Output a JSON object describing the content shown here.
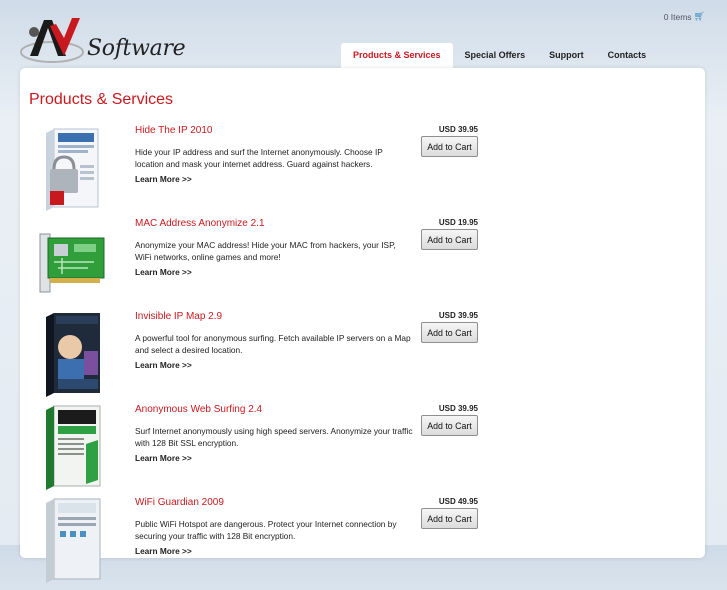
{
  "header": {
    "logo_text": "Software",
    "cart_text": "0 Items"
  },
  "nav": {
    "items": [
      {
        "label": "Products & Services",
        "active": true
      },
      {
        "label": "Special Offers",
        "active": false
      },
      {
        "label": "Support",
        "active": false
      },
      {
        "label": "Contacts",
        "active": false
      }
    ]
  },
  "main": {
    "title": "Products & Services",
    "learn_more_label": "Learn More >>",
    "add_to_cart_label": "Add to Cart",
    "products": [
      {
        "name": "Hide The IP 2010",
        "price": "USD 39.95",
        "description": "Hide your IP address and surf the Internet anonymously. Choose IP location and mask your internet address. Guard against hackers."
      },
      {
        "name": "MAC Address Anonymize 2.1",
        "price": "USD 19.95",
        "description": "Anonymize your MAC address! Hide your MAC from hackers, your ISP, WiFi networks, online games and more!"
      },
      {
        "name": "Invisible IP Map 2.9",
        "price": "USD 39.95",
        "description": "A powerful tool for anonymous surfing. Fetch available IP servers on a Map and select a desired location."
      },
      {
        "name": "Anonymous Web Surfing 2.4",
        "price": "USD 39.95",
        "description": "Surf Internet anonymously using high speed servers. Anonymize your traffic with 128 Bit SSL encryption."
      },
      {
        "name": "WiFi Guardian 2009",
        "price": "USD 49.95",
        "description": "Public WiFi Hotspot are dangerous. Protect your Internet connection by securing your traffic with 128 Bit encryption."
      }
    ]
  },
  "colors": {
    "accent": "#c8191f",
    "panel": "#ffffff",
    "background": "#dde6ef"
  }
}
